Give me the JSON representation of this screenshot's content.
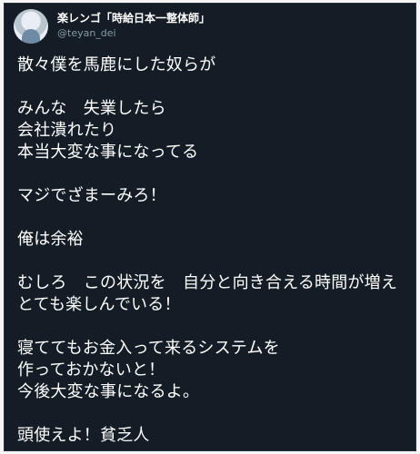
{
  "tweet": {
    "author_name": "楽レンゴ「時給日本一整体師」",
    "author_handle": "@teyan_dei",
    "body": "散々僕を馬鹿にした奴らが\n\nみんな　失業したら\n会社潰れたり\n本当大変な事になってる\n\nマジでざまーみろ！\n\n俺は余裕\n\nむしろ　この状況を　自分と向き合える時間が増え\nとても楽しんでいる！\n\n寝ててもお金入って来るシステムを\n作っておかないと！\n今後大変な事になるよ。\n\n頭使えよ！貧乏人",
    "avatar_icon": "profile-photo-icon"
  }
}
